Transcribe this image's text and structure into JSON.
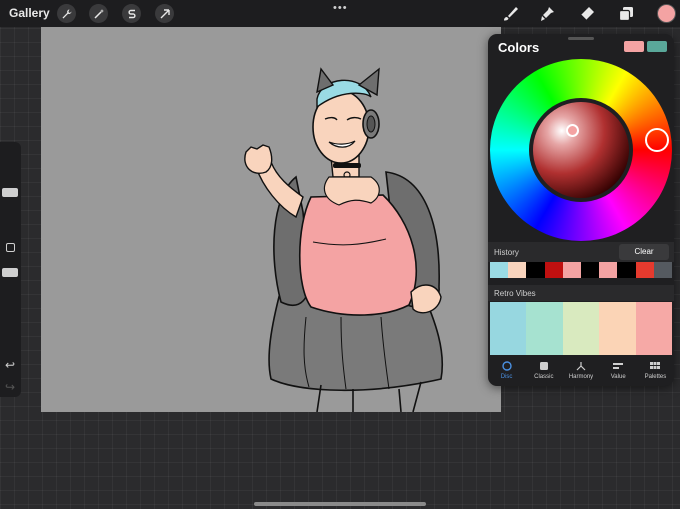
{
  "topbar": {
    "gallery_label": "Gallery",
    "left_tools": [
      {
        "icon": "wrench-icon",
        "name": "actions-button"
      },
      {
        "icon": "magic-wand-icon",
        "name": "adjustments-button"
      },
      {
        "icon": "selection-s-icon",
        "name": "selection-button"
      },
      {
        "icon": "arrow-cursor-icon",
        "name": "transform-button"
      }
    ],
    "more_dots": "•••",
    "right_tools": [
      {
        "icon": "brush-icon",
        "name": "brush-tool"
      },
      {
        "icon": "smudge-icon",
        "name": "smudge-tool"
      },
      {
        "icon": "eraser-icon",
        "name": "eraser-tool"
      },
      {
        "icon": "layers-icon",
        "name": "layers-button"
      }
    ],
    "active_color": "#f4a3a3"
  },
  "sidebar": {
    "undo_glyph": "↩",
    "redo_glyph": "↪"
  },
  "colors_panel": {
    "title": "Colors",
    "primary_swatch": "#f4a3a3",
    "secondary_swatch": "#5aa89a",
    "history_label": "History",
    "clear_label": "Clear",
    "history_colors": [
      "#9adbe4",
      "#f9d4bd",
      "#000000",
      "#c01010",
      "#f4a3a3",
      "#000000",
      "#f4a3a3",
      "#000000",
      "#e53a2e",
      "#555a60"
    ],
    "palette_name": "Retro Vibes",
    "palette_colors": [
      "#97d7e0",
      "#a6e2d0",
      "#d9eabf",
      "#fbd4b6",
      "#f6a9a6"
    ],
    "tabs": [
      {
        "label": "Disc",
        "icon": "disc-icon",
        "active": true
      },
      {
        "label": "Classic",
        "icon": "classic-square-icon",
        "active": false
      },
      {
        "label": "Harmony",
        "icon": "harmony-icon",
        "active": false
      },
      {
        "label": "Value",
        "icon": "value-sliders-icon",
        "active": false
      },
      {
        "label": "Palettes",
        "icon": "palettes-grid-icon",
        "active": false
      }
    ]
  }
}
